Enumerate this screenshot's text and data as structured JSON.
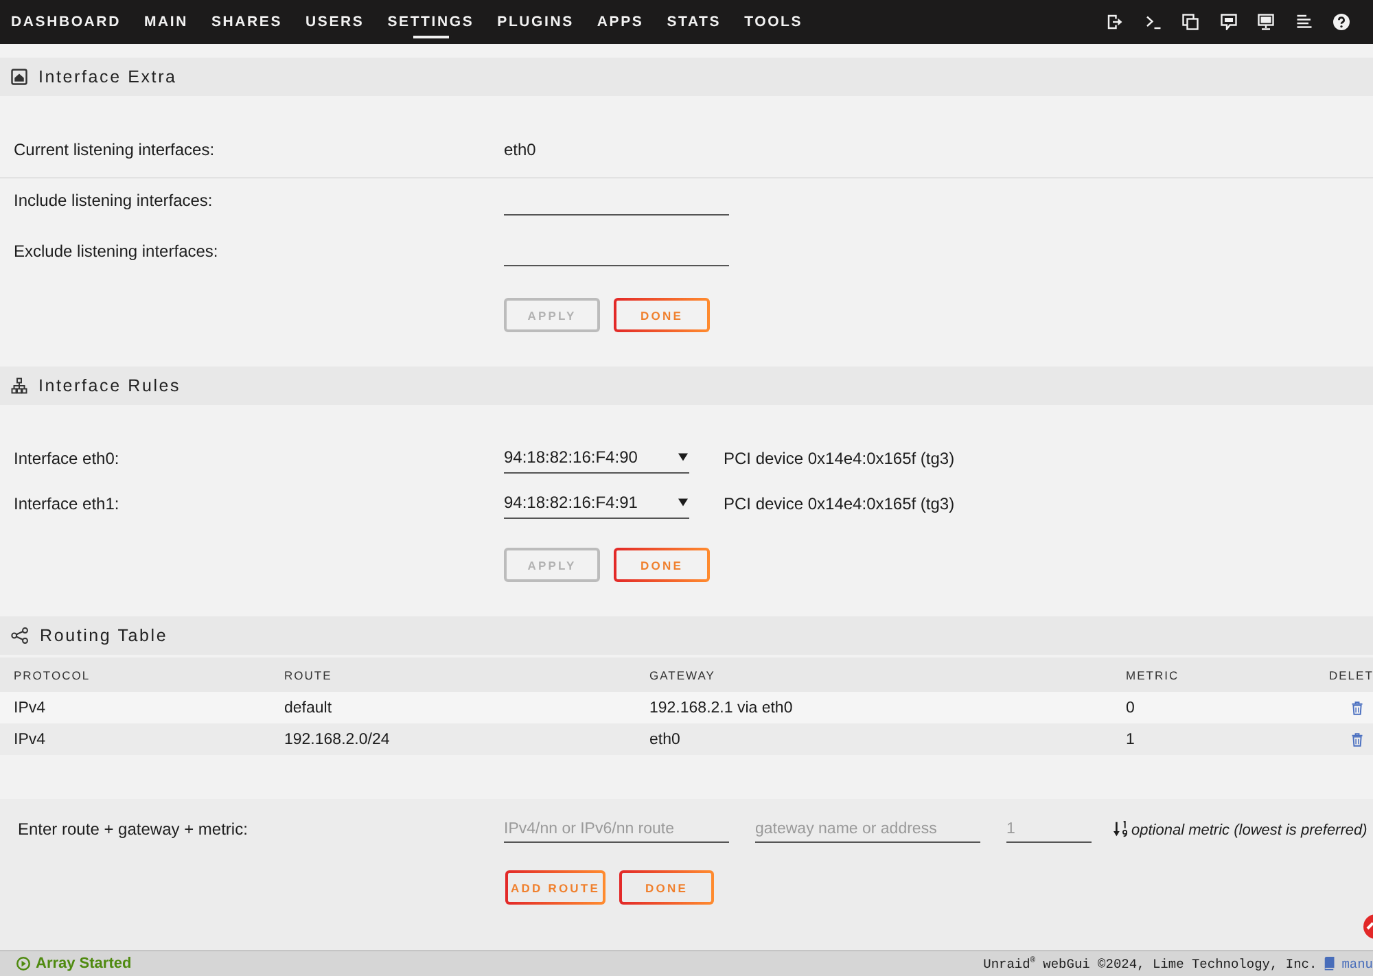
{
  "nav": {
    "items": [
      {
        "label": "DASHBOARD",
        "selected": false
      },
      {
        "label": "MAIN",
        "selected": false
      },
      {
        "label": "SHARES",
        "selected": false
      },
      {
        "label": "USERS",
        "selected": false
      },
      {
        "label": "SETTINGS",
        "selected": true
      },
      {
        "label": "PLUGINS",
        "selected": false
      },
      {
        "label": "APPS",
        "selected": false
      },
      {
        "label": "STATS",
        "selected": false
      },
      {
        "label": "TOOLS",
        "selected": false
      }
    ]
  },
  "interface_extra": {
    "title": "Interface Extra",
    "current": {
      "label": "Current listening interfaces:",
      "value": "eth0"
    },
    "include": {
      "label": "Include listening interfaces:"
    },
    "exclude": {
      "label": "Exclude listening interfaces:"
    },
    "buttons": [
      {
        "label": "APPLY",
        "disabled": true
      },
      {
        "label": "DONE",
        "disabled": false
      }
    ]
  },
  "interface_rules": {
    "title": "Interface Rules",
    "rows": [
      {
        "label": "Interface eth0:",
        "value": "94:18:82:16:F4:90",
        "device": "PCI device 0x14e4:0x165f (tg3)"
      },
      {
        "label": "Interface eth1:",
        "value": "94:18:82:16:F4:91",
        "device": "PCI device 0x14e4:0x165f (tg3)"
      }
    ],
    "buttons": [
      {
        "label": "APPLY",
        "disabled": true
      },
      {
        "label": "DONE",
        "disabled": false
      }
    ]
  },
  "routing_table": {
    "title": "Routing Table",
    "columns": [
      "PROTOCOL",
      "ROUTE",
      "GATEWAY",
      "METRIC",
      "DELET"
    ],
    "rows": [
      {
        "cells": [
          "IPv4",
          "default",
          "192.168.2.1 via eth0",
          "0"
        ]
      },
      {
        "cells": [
          "IPv4",
          "192.168.2.0/24",
          "eth0",
          "1"
        ]
      }
    ]
  },
  "add_route": {
    "label": "Enter route + gateway + metric:",
    "fields": [
      {
        "placeholder": "IPv4/nn or IPv6/nn route"
      },
      {
        "placeholder": "gateway name or address"
      },
      {
        "placeholder": "1"
      }
    ],
    "hint": "optional metric (lowest is preferred)",
    "buttons": [
      {
        "label": "ADD ROUTE",
        "disabled": false
      },
      {
        "label": "DONE",
        "disabled": false
      }
    ]
  },
  "status_bar": {
    "array_status": "Array Started",
    "copyright": "Unraid$^{®}$ webGui ©2024, Lime Technology, Inc.",
    "manual_link": "manu"
  }
}
